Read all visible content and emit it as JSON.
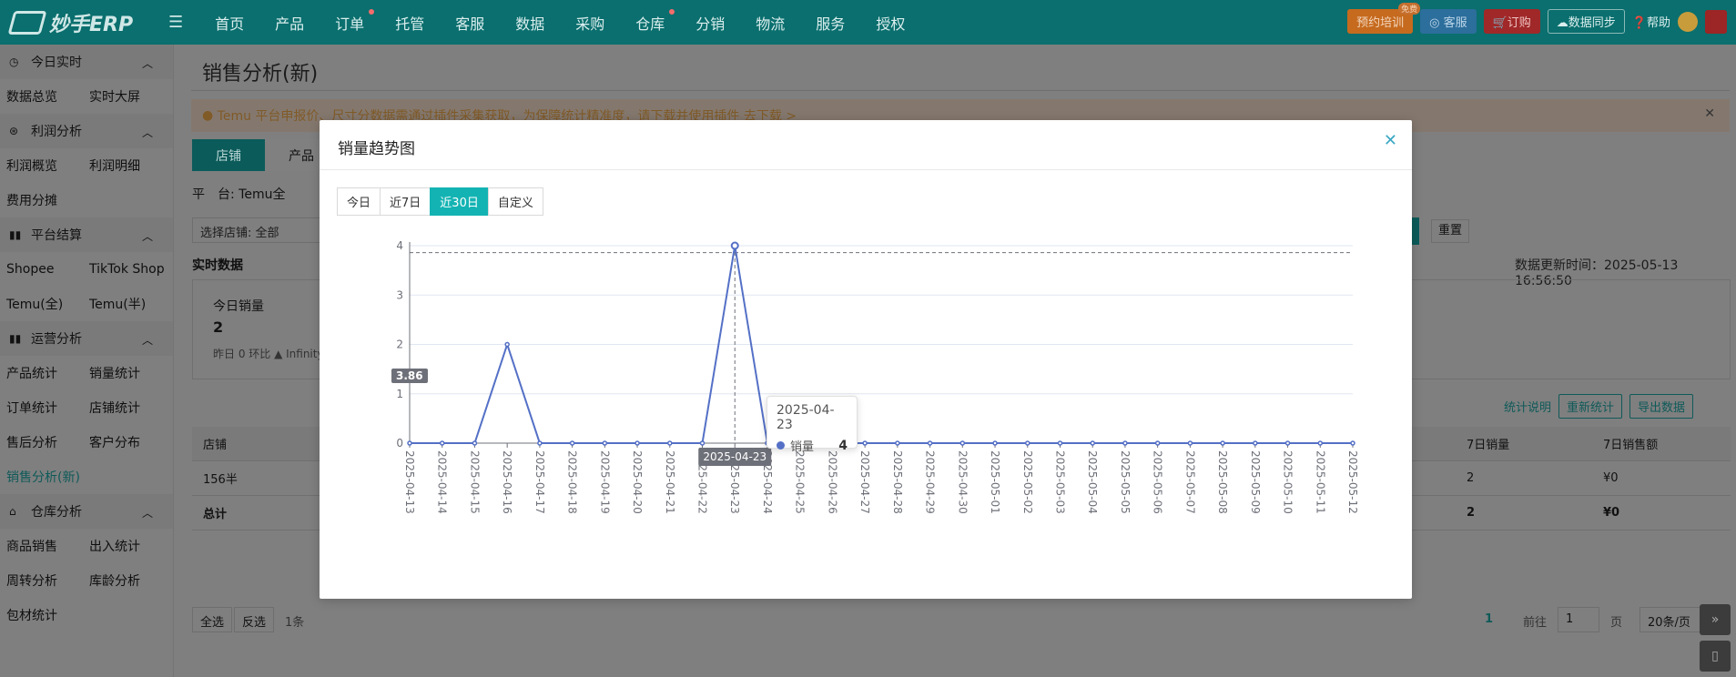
{
  "app": {
    "logo_text": "妙手ERP"
  },
  "nav": {
    "items": [
      "首页",
      "产品",
      "订单",
      "托管",
      "客服",
      "数据",
      "采购",
      "仓库",
      "分销",
      "物流",
      "服务",
      "授权"
    ],
    "dots": [
      false,
      false,
      true,
      false,
      false,
      false,
      false,
      true,
      false,
      false,
      false,
      false
    ]
  },
  "topright": {
    "training": "预约培训",
    "training_tag": "免费",
    "service": "客服",
    "order": "订购",
    "sync": "数据同步",
    "help": "帮助"
  },
  "sidebar": {
    "groups": [
      {
        "title": "今日实时",
        "rows": [
          [
            "数据总览",
            "实时大屏"
          ]
        ]
      },
      {
        "title": "利润分析",
        "rows": [
          [
            "利润概览",
            "利润明细"
          ],
          [
            "费用分摊",
            ""
          ]
        ]
      },
      {
        "title": "平台结算",
        "rows": [
          [
            "Shopee",
            "TikTok Shop"
          ],
          [
            "Temu(全)",
            "Temu(半)"
          ]
        ]
      },
      {
        "title": "运营分析",
        "rows": [
          [
            "产品统计",
            "销量统计"
          ],
          [
            "订单统计",
            "店铺统计"
          ],
          [
            "售后分析",
            "客户分布"
          ],
          [
            "销售分析(新)",
            ""
          ]
        ]
      },
      {
        "title": "仓库分析",
        "rows": [
          [
            "商品销售",
            "出入统计"
          ],
          [
            "周转分析",
            "库龄分析"
          ],
          [
            "包材统计",
            ""
          ]
        ]
      }
    ],
    "active": "销售分析(新)"
  },
  "main": {
    "title": "销售分析(新)",
    "notice": "Temu 平台申报价、尺寸分数据需通过插件采集获取，为保障统计精准度，请下载并使用插件 去下载 >",
    "tabs": [
      "店铺",
      "产品"
    ],
    "platform_label": "平　台:",
    "platform_value": "Temu全",
    "shop_select_label": "选择店铺:",
    "shop_select_value": "全部",
    "reset": "重置",
    "realtime": "实时数据",
    "update_time": "数据更新时间：2025-05-13 16:56:50",
    "card": {
      "label": "今日销量",
      "value": "2",
      "sub": "昨日 0  环比 ▲ Infinity"
    },
    "links": {
      "explain": "统计说明",
      "recount": "重新统计",
      "export": "导出数据"
    },
    "table": {
      "headers": [
        "店铺",
        "7日销量",
        "7日销售额"
      ],
      "rows": [
        [
          "156半",
          "2",
          "¥0"
        ]
      ],
      "total": [
        "总计",
        "2",
        "¥0"
      ]
    },
    "pager": {
      "select_all": "全选",
      "invert": "反选",
      "count": "1条",
      "page": "1",
      "goto": "前往",
      "goto_page": "1",
      "page_unit": "页",
      "page_size": "20条/页"
    }
  },
  "modal": {
    "title": "销量趋势图",
    "ranges": [
      "今日",
      "近7日",
      "近30日",
      "自定义"
    ],
    "active_range": "近30日",
    "tooltip": {
      "date": "2025-04-23",
      "series": "销量",
      "value": "4"
    },
    "axis_pointer_y": "3.86",
    "axis_pointer_x": "2025-04-23"
  },
  "chart_data": {
    "type": "line",
    "x": [
      "2025-04-13",
      "2025-04-14",
      "2025-04-15",
      "2025-04-16",
      "2025-04-17",
      "2025-04-18",
      "2025-04-19",
      "2025-04-20",
      "2025-04-21",
      "2025-04-22",
      "2025-04-23",
      "2025-04-24",
      "2025-04-25",
      "2025-04-26",
      "2025-04-27",
      "2025-04-28",
      "2025-04-29",
      "2025-04-30",
      "2025-05-01",
      "2025-05-02",
      "2025-05-03",
      "2025-05-04",
      "2025-05-05",
      "2025-05-06",
      "2025-05-07",
      "2025-05-08",
      "2025-05-09",
      "2025-05-10",
      "2025-05-11",
      "2025-05-12"
    ],
    "series": [
      {
        "name": "销量",
        "values": [
          0,
          0,
          0,
          2,
          0,
          0,
          0,
          0,
          0,
          0,
          4,
          0,
          0,
          0,
          0,
          0,
          0,
          0,
          0,
          0,
          0,
          0,
          0,
          0,
          0,
          0,
          0,
          0,
          0,
          0
        ]
      }
    ],
    "ylim": [
      0,
      4
    ],
    "yticks": [
      0,
      1,
      2,
      3,
      4
    ],
    "color": "#5470c6",
    "grid": true
  }
}
